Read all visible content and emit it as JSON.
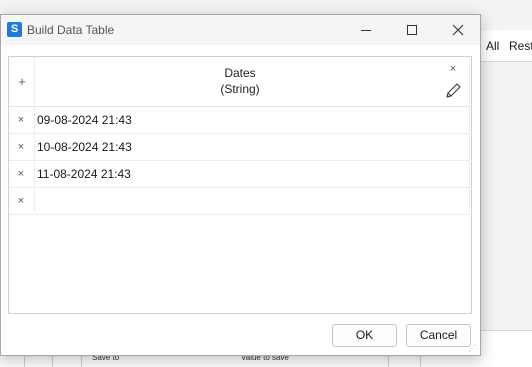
{
  "background": {
    "toolbar_links": [
      "All",
      "Rest"
    ],
    "grid_headers": [
      "Save to",
      "Value to save"
    ]
  },
  "dialog": {
    "title": "Build Data Table",
    "app_icon_glyph": "S",
    "accent_color": "#1f7ad8"
  },
  "table": {
    "add_glyph": "+",
    "delete_glyph": "×",
    "column": {
      "name": "Dates",
      "type": "(String)"
    },
    "rows": [
      {
        "value": "09-08-2024 21:43"
      },
      {
        "value": "10-08-2024 21:43"
      },
      {
        "value": "11-08-2024 21:43"
      },
      {
        "value": ""
      }
    ]
  },
  "buttons": {
    "ok": "OK",
    "cancel": "Cancel"
  }
}
